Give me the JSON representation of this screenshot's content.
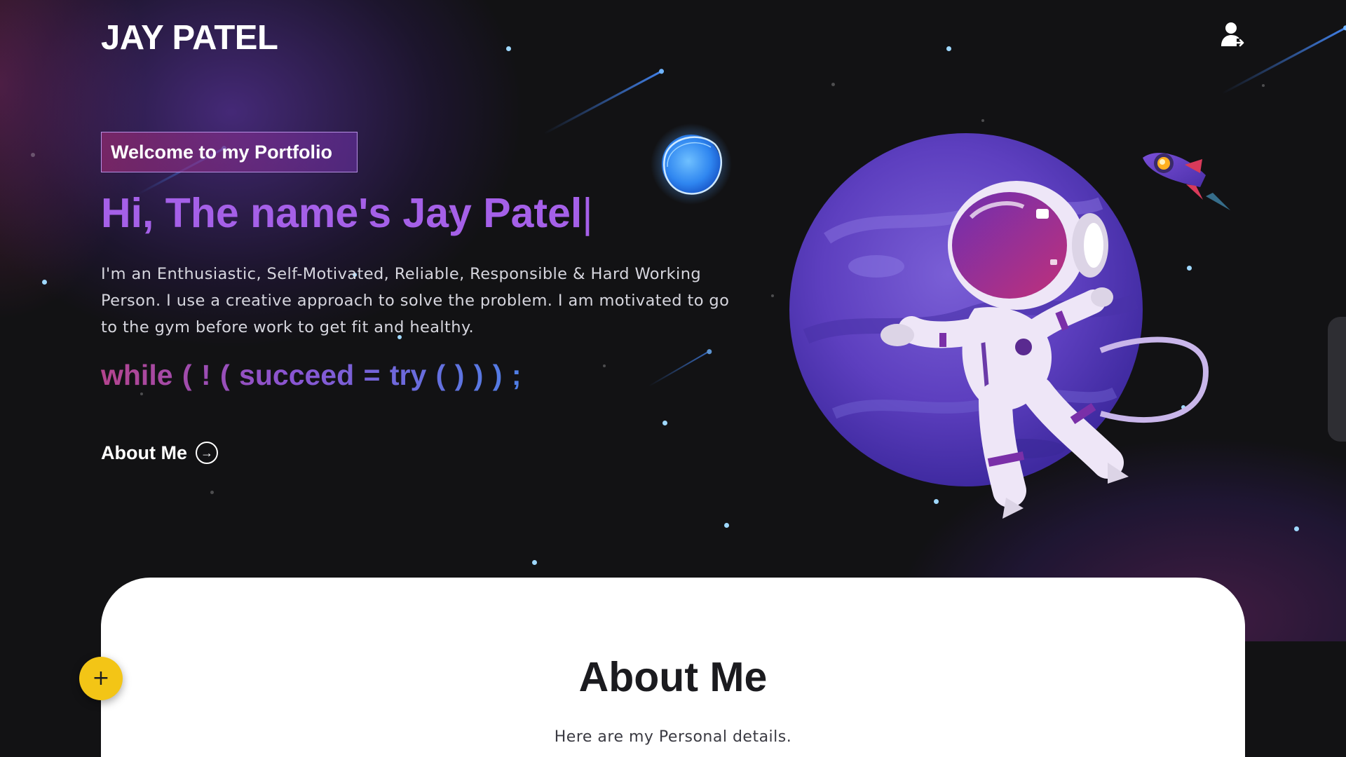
{
  "header": {
    "logo": "JAY PATEL",
    "user_icon": "user-arrow-icon"
  },
  "hero": {
    "badge": "Welcome to my Portfolio",
    "headline": "Hi, The name's Jay Patel",
    "caret": "|",
    "bio": "I'm an Enthusiastic, Self-Motivated, Reliable, Responsible & Hard Working Person. I use a creative approach to solve the problem. I am motivated to go to the gym before work to get fit and healthy.",
    "code_line": "while ( ! ( succeed = try ( ) ) ) ;",
    "about_link": "About Me",
    "about_link_icon": "arrow-right-circle-icon"
  },
  "about": {
    "title": "About Me",
    "subtitle": "Here are my Personal details."
  },
  "fab": {
    "label": "+",
    "icon": "plus-icon"
  },
  "colors": {
    "accent_purple": "#a560e8",
    "fab_yellow": "#f3c516",
    "background": "#121214"
  }
}
